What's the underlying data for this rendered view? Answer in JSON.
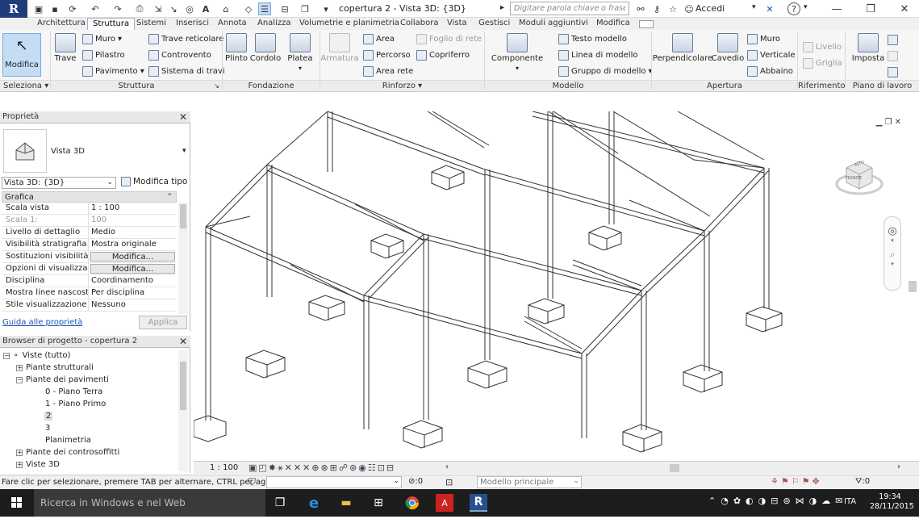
{
  "titlebar": {
    "app_letter": "R",
    "doc_title": "copertura 2 - Vista 3D: {3D}",
    "search_placeholder": "Digitare parola chiave o frase",
    "accedi": "Accedi",
    "help": "?"
  },
  "tabs": [
    "Architettura",
    "Struttura",
    "Sistemi",
    "Inserisci",
    "Annota",
    "Analizza",
    "Volumetrie e planimetria",
    "Collabora",
    "Vista",
    "Gestisci",
    "Moduli aggiuntivi",
    "Modifica"
  ],
  "active_tab": "Struttura",
  "ribbon": {
    "modifica": "Modifica",
    "trave": "Trave",
    "muro": "Muro",
    "pilastro": "Pilastro",
    "pavimento": "Pavimento",
    "trave_reticolare": "Trave reticolare",
    "controvento": "Controvento",
    "sistema_travi": "Sistema di travi",
    "plinto": "Plinto",
    "cordolo": "Cordolo",
    "platea": "Platea",
    "armatura": "Armatura",
    "area": "Area",
    "percorso": "Percorso",
    "area_rete": "Area  rete",
    "foglio_rete": "Foglio  di rete",
    "copriferro": "Copriferro",
    "componente": "Componente",
    "testo_modello": "Testo modello",
    "linea_modello": "Linea di modello",
    "gruppo_modello": "Gruppo di modello",
    "perpendicolare": "Perpendicolare",
    "cavedio": "Cavedio",
    "muro2": "Muro",
    "verticale": "Verticale",
    "abbaino": "Abbaino",
    "livello": "Livello",
    "griglia": "Griglia",
    "imposta": "Imposta",
    "groups": {
      "seleziona": "Seleziona",
      "struttura": "Struttura",
      "fondazione": "Fondazione",
      "rinforzo": "Rinforzo",
      "modello": "Modello",
      "apertura": "Apertura",
      "riferimento": "Riferimento",
      "piano_lavoro": "Piano di lavoro"
    }
  },
  "properties": {
    "header": "Proprietà",
    "type_name": "Vista 3D",
    "view_selector": "Vista 3D: {3D}",
    "modifica_tipo": "Modifica tipo",
    "section": "Grafica",
    "rows": [
      {
        "k": "Scala vista",
        "v": "1 : 100",
        "grey": false
      },
      {
        "k": "Scala  1:",
        "v": "100",
        "grey": true
      },
      {
        "k": "Livello di dettaglio",
        "v": "Medio",
        "grey": false
      },
      {
        "k": "Visibilità stratigrafia",
        "v": "Mostra originale",
        "grey": false
      },
      {
        "k": "Sostituzioni visibilità/...",
        "v": "Modifica...",
        "btn": true
      },
      {
        "k": "Opzioni di visualizzaz...",
        "v": "Modifica...",
        "btn": true
      },
      {
        "k": "Disciplina",
        "v": "Coordinamento",
        "grey": false
      },
      {
        "k": "Mostra linee nascoste",
        "v": "Per disciplina",
        "grey": false
      },
      {
        "k": "Stile visualizzazione a...",
        "v": "Nessuno",
        "grey": false
      }
    ],
    "help_link": "Guida alle proprietà",
    "apply": "Applica"
  },
  "browser": {
    "header": "Browser di progetto - copertura 2",
    "items": [
      {
        "label": "Viste (tutto)",
        "level": 0,
        "exp": "-"
      },
      {
        "label": "Piante strutturali",
        "level": 1,
        "exp": "+"
      },
      {
        "label": "Piante dei pavimenti",
        "level": 1,
        "exp": "-"
      },
      {
        "label": "0 - Piano Terra",
        "level": 2,
        "exp": ""
      },
      {
        "label": "1 - Piano Primo",
        "level": 2,
        "exp": ""
      },
      {
        "label": "2",
        "level": 2,
        "exp": "",
        "selected": true
      },
      {
        "label": "3",
        "level": 2,
        "exp": ""
      },
      {
        "label": "Planimetria",
        "level": 2,
        "exp": ""
      },
      {
        "label": "Piante dei controsoffitti",
        "level": 1,
        "exp": "+"
      },
      {
        "label": "Viste 3D",
        "level": 1,
        "exp": "+"
      }
    ]
  },
  "viewcube": {
    "top": "ALTO",
    "front": "FRONTE"
  },
  "viewbar": {
    "scale": "1 : 100"
  },
  "status": {
    "text": "Fare clic per selezionare, premere TAB per alternare, CTRL per aggiun",
    "count": ":0",
    "model": "Modello principale",
    "filter": ":0"
  },
  "taskbar": {
    "search": "Ricerca in Windows e nel Web",
    "lang": "ITA",
    "time": "19:34",
    "date": "28/11/2015"
  }
}
